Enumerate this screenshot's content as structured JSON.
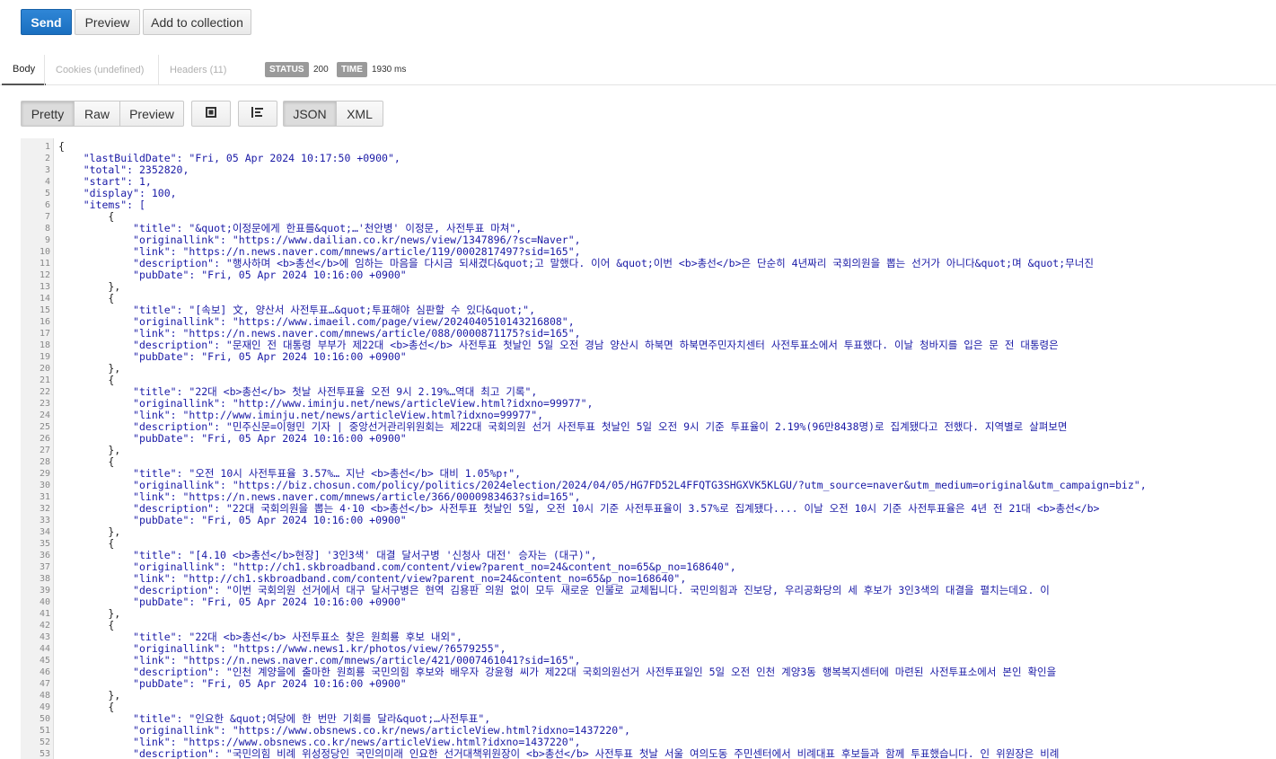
{
  "toolbar": {
    "send_label": "Send",
    "preview_label": "Preview",
    "add_collection_label": "Add to collection"
  },
  "response_tabs": {
    "body": "Body",
    "cookies": "Cookies (undefined)",
    "headers": "Headers (11)"
  },
  "status": {
    "label": "STATUS",
    "value": "200"
  },
  "time": {
    "label": "TIME",
    "value": "1930 ms"
  },
  "view_modes": {
    "pretty": "Pretty",
    "raw": "Raw",
    "preview": "Preview"
  },
  "formats": {
    "json": "JSON",
    "xml": "XML"
  },
  "icons": {
    "fullscreen": "fullscreen-icon",
    "wrap": "wrap-lines-icon"
  },
  "code_lines": [
    "{",
    "    \"lastBuildDate\": \"Fri, 05 Apr 2024 10:17:50 +0900\",",
    "    \"total\": 2352820,",
    "    \"start\": 1,",
    "    \"display\": 100,",
    "    \"items\": [",
    "        {",
    "            \"title\": \"&quot;이정문에게 한표를&quot;…'천안병' 이정문, 사전투표 마쳐\",",
    "            \"originallink\": \"https://www.dailian.co.kr/news/view/1347896/?sc=Naver\",",
    "            \"link\": \"https://n.news.naver.com/mnews/article/119/0002817497?sid=165\",",
    "            \"description\": \"행사하며 <b>총선</b>에 임하는 마음을 다시금 되새겼다&quot;고 말했다. 이어 &quot;이번 <b>총선</b>은 단순히 4년짜리 국회의원을 뽑는 선거가 아니다&quot;며 &quot;무너진",
    "            \"pubDate\": \"Fri, 05 Apr 2024 10:16:00 +0900\"",
    "        },",
    "        {",
    "            \"title\": \"[속보] 文, 양산서 사전투표…&quot;투표해야 심판할 수 있다&quot;\",",
    "            \"originallink\": \"https://www.imaeil.com/page/view/2024040510143216808\",",
    "            \"link\": \"https://n.news.naver.com/mnews/article/088/0000871175?sid=165\",",
    "            \"description\": \"문재인 전 대통령 부부가 제22대 <b>총선</b> 사전투표 첫날인 5일 오전 경남 양산시 하북면 하북면주민자치센터 사전투표소에서 투표했다. 이날 청바지를 입은 문 전 대통령은",
    "            \"pubDate\": \"Fri, 05 Apr 2024 10:16:00 +0900\"",
    "        },",
    "        {",
    "            \"title\": \"22대 <b>총선</b> 첫날 사전투표율 오전 9시 2.19%…역대 최고 기록\",",
    "            \"originallink\": \"http://www.iminju.net/news/articleView.html?idxno=99977\",",
    "            \"link\": \"http://www.iminju.net/news/articleView.html?idxno=99977\",",
    "            \"description\": \"민주신문=이형민 기자 | 중앙선거관리위원회는 제22대 국회의원 선거 사전투표 첫날인 5일 오전 9시 기준 투표율이 2.19%(96만8438명)로 집계됐다고 전했다. 지역별로 살펴보면",
    "            \"pubDate\": \"Fri, 05 Apr 2024 10:16:00 +0900\"",
    "        },",
    "        {",
    "            \"title\": \"오전 10시 사전투표율 3.57%… 지난 <b>총선</b> 대비 1.05%p↑\",",
    "            \"originallink\": \"https://biz.chosun.com/policy/politics/2024election/2024/04/05/HG7FD52L4FFQTG3SHGXVK5KLGU/?utm_source=naver&utm_medium=original&utm_campaign=biz\",",
    "            \"link\": \"https://n.news.naver.com/mnews/article/366/0000983463?sid=165\",",
    "            \"description\": \"22대 국회의원을 뽑는 4·10 <b>총선</b> 사전투표 첫날인 5일, 오전 10시 기준 사전투표율이 3.57%로 집계됐다.... 이날 오전 10시 기준 사전투표율은 4년 전 21대 <b>총선</b>",
    "            \"pubDate\": \"Fri, 05 Apr 2024 10:16:00 +0900\"",
    "        },",
    "        {",
    "            \"title\": \"[4.10 <b>총선</b>현장] '3인3색' 대결 달서구병 '신청사 대전' 승자는 (대구)\",",
    "            \"originallink\": \"http://ch1.skbroadband.com/content/view?parent_no=24&content_no=65&p_no=168640\",",
    "            \"link\": \"http://ch1.skbroadband.com/content/view?parent_no=24&content_no=65&p_no=168640\",",
    "            \"description\": \"이번 국회의원 선거에서 대구 달서구병은 현역 김용판 의원 없이 모두 새로운 인물로 교체됩니다. 국민의힘과 진보당, 우리공화당의 세 후보가 3인3색의 대결을 펼치는데요. 이",
    "            \"pubDate\": \"Fri, 05 Apr 2024 10:16:00 +0900\"",
    "        },",
    "        {",
    "            \"title\": \"22대 <b>총선</b> 사전투표소 찾은 원희룡 후보 내외\",",
    "            \"originallink\": \"https://www.news1.kr/photos/view/?6579255\",",
    "            \"link\": \"https://n.news.naver.com/mnews/article/421/0007461041?sid=165\",",
    "            \"description\": \"인천 계양을에 출마한 원희룡 국민의힘 후보와 배우자 강윤형 씨가 제22대 국회의원선거 사전투표일인 5일 오전 인천 계양3동 행복복지센터에 마련된 사전투표소에서 본인 확인을",
    "            \"pubDate\": \"Fri, 05 Apr 2024 10:16:00 +0900\"",
    "        },",
    "        {",
    "            \"title\": \"인요한 &quot;여당에 한 번만 기회를 달라&quot;…사전투표\",",
    "            \"originallink\": \"https://www.obsnews.co.kr/news/articleView.html?idxno=1437220\",",
    "            \"link\": \"https://www.obsnews.co.kr/news/articleView.html?idxno=1437220\",",
    "            \"description\": \"국민의힘 비례 위성정당인 국민의미래 인요한 선거대책위원장이 <b>총선</b> 사전투표 첫날 서울 여의도동 주민센터에서 비례대표 후보들과 함께 투표했습니다. 인 위원장은 비례"
  ]
}
